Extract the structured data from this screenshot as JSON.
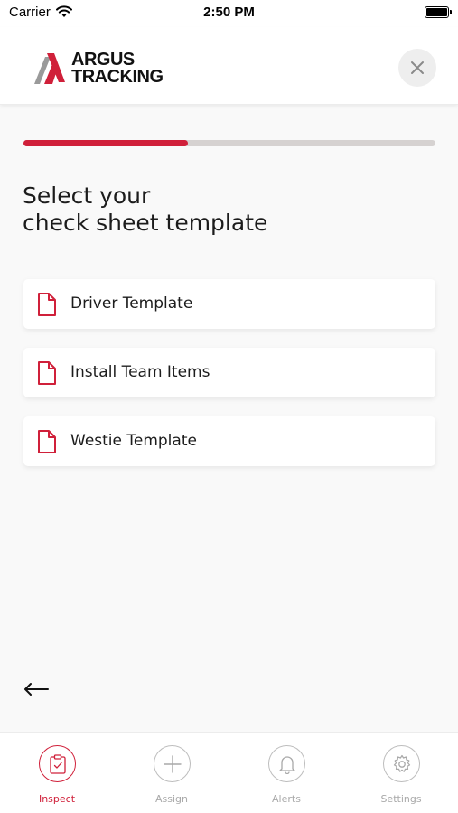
{
  "status_bar": {
    "carrier": "Carrier",
    "time": "2:50 PM",
    "icons": [
      "wifi-icon",
      "battery-icon"
    ]
  },
  "header": {
    "logo_line1": "ARGUS",
    "logo_line2": "TRACKING",
    "close_icon": "close-icon"
  },
  "progress": {
    "value": 0.4
  },
  "page": {
    "title_line1": "Select your",
    "title_line2": "check sheet template"
  },
  "templates": [
    {
      "label": "Driver Template",
      "icon": "document-icon"
    },
    {
      "label": "Install Team Items",
      "icon": "document-icon"
    },
    {
      "label": "Westie Template",
      "icon": "document-icon"
    }
  ],
  "back_icon": "back-arrow-icon",
  "tab_bar": [
    {
      "label": "Inspect",
      "icon": "clipboard-check-icon",
      "active": true
    },
    {
      "label": "Assign",
      "icon": "plus-icon",
      "active": false
    },
    {
      "label": "Alerts",
      "icon": "bell-icon",
      "active": false
    },
    {
      "label": "Settings",
      "icon": "gear-icon",
      "active": false
    }
  ],
  "colors": {
    "accent": "#d0203a",
    "progress_track": "#d6d2d1",
    "background": "#f9f9f9",
    "inactive_tab": "#a9a9a9"
  }
}
